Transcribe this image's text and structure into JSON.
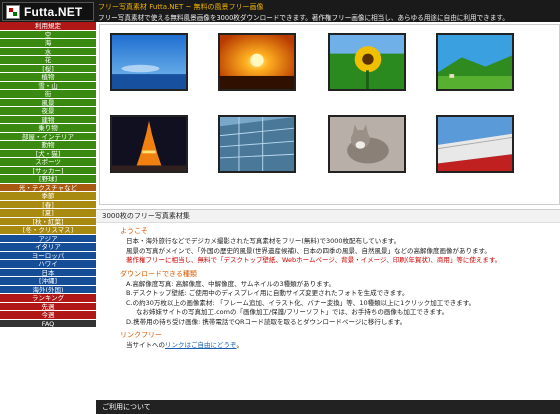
{
  "header": {
    "logo": "Futta.NET",
    "tagline": "フリー写真素材 Futta.NET ~ 無料の風景フリー画像",
    "desc": "フリー写真素材で使える無料風景画像を3000枚ダウンロードできます。著作権フリー画像に相当し、あらゆる用途に自由に利用できます。"
  },
  "sidebar": [
    {
      "label": "利用規定",
      "cls": "side-head"
    },
    {
      "label": "空",
      "cls": "g"
    },
    {
      "label": "海",
      "cls": "g"
    },
    {
      "label": "水",
      "cls": "g"
    },
    {
      "label": "花",
      "cls": "g"
    },
    {
      "label": "[桜]",
      "cls": "g"
    },
    {
      "label": "植物",
      "cls": "g"
    },
    {
      "label": "雪・山",
      "cls": "g"
    },
    {
      "label": "街",
      "cls": "g"
    },
    {
      "label": "風景",
      "cls": "g"
    },
    {
      "label": "夜景",
      "cls": "g"
    },
    {
      "label": "建物",
      "cls": "g"
    },
    {
      "label": "乗り物",
      "cls": "g"
    },
    {
      "label": "部屋・インテリア",
      "cls": "g"
    },
    {
      "label": "動物",
      "cls": "g"
    },
    {
      "label": "[犬・猫]",
      "cls": "g"
    },
    {
      "label": "スポーツ",
      "cls": "g"
    },
    {
      "label": "[サッカー]",
      "cls": "g"
    },
    {
      "label": "[野球]",
      "cls": "g"
    },
    {
      "label": "光・テクスチャなど",
      "cls": "o"
    },
    {
      "label": "季節",
      "cls": "y"
    },
    {
      "label": "[春]",
      "cls": "y"
    },
    {
      "label": "[夏]",
      "cls": "y"
    },
    {
      "label": "[秋・紅葉]",
      "cls": "y"
    },
    {
      "label": "[冬・クリスマス]",
      "cls": "y"
    },
    {
      "label": "アジア",
      "cls": "b"
    },
    {
      "label": "イタリア",
      "cls": "b"
    },
    {
      "label": "ヨーロッパ",
      "cls": "b"
    },
    {
      "label": "ハワイ",
      "cls": "b"
    },
    {
      "label": "日本",
      "cls": "b"
    },
    {
      "label": "[沖縄]",
      "cls": "b"
    },
    {
      "label": "海外(外国)",
      "cls": "b"
    },
    {
      "label": "ランキング",
      "cls": "r"
    },
    {
      "label": "先週",
      "cls": "r"
    },
    {
      "label": "今週",
      "cls": "r"
    },
    {
      "label": "FAQ",
      "cls": "bl"
    }
  ],
  "gallery": [
    {
      "name": "sky-sea"
    },
    {
      "name": "sunset"
    },
    {
      "name": "sunflower"
    },
    {
      "name": "meadow"
    },
    {
      "name": "tokyo-tower"
    },
    {
      "name": "glass-building"
    },
    {
      "name": "cat"
    },
    {
      "name": "stadium"
    }
  ],
  "main": {
    "section_title": "3000枚のフリー写真素材集",
    "welcome_title": "ようこそ",
    "welcome_lines": [
      "日本・海外旅行などでデジカメ撮影された写真素材をフリー(無料)で3000枚配布しています。",
      "風景の写真がメインで、「外国の歴史的風景(世界遺産候補)、日本の四季の風景、自然風景」などの高解像度画像があります。",
      "著作権フリーに相当し、無料で「デスクトップ壁紙、Webホームページ、背景・イメージ、印刷(年賀状)、商用」等に使えます。"
    ],
    "dl_title": "ダウンロードできる種類",
    "dl_lines": [
      "A.高解像度写真: 高解像度、中解像度、サムネイルの3種類があります。",
      "B.デスクトップ壁紙: ご使用中のディスプレイ用に自動サイズ変更されたフォトを生成できます。",
      "C.の約30万枚以上の画像素材: 「フレーム追加、イラスト化、バナー変換」等、10種類以上に1クリック加工できます。",
      "なお姉妹サイトの写真加工.comの「画像加工/保護/フリーソフト」では、お手持ちの画像も加工できます。",
      "D.携帯用の待ち受け画像: 携帯電話でQRコード読取を取るとダウンロードページに移行します。"
    ],
    "link_title": "リンクフリー",
    "link_line_prefix": "当サイトへの",
    "link_line_link": "リンクはご自由にどうぞ",
    "link_line_suffix": "。"
  },
  "footer_bar": "ご利用について"
}
